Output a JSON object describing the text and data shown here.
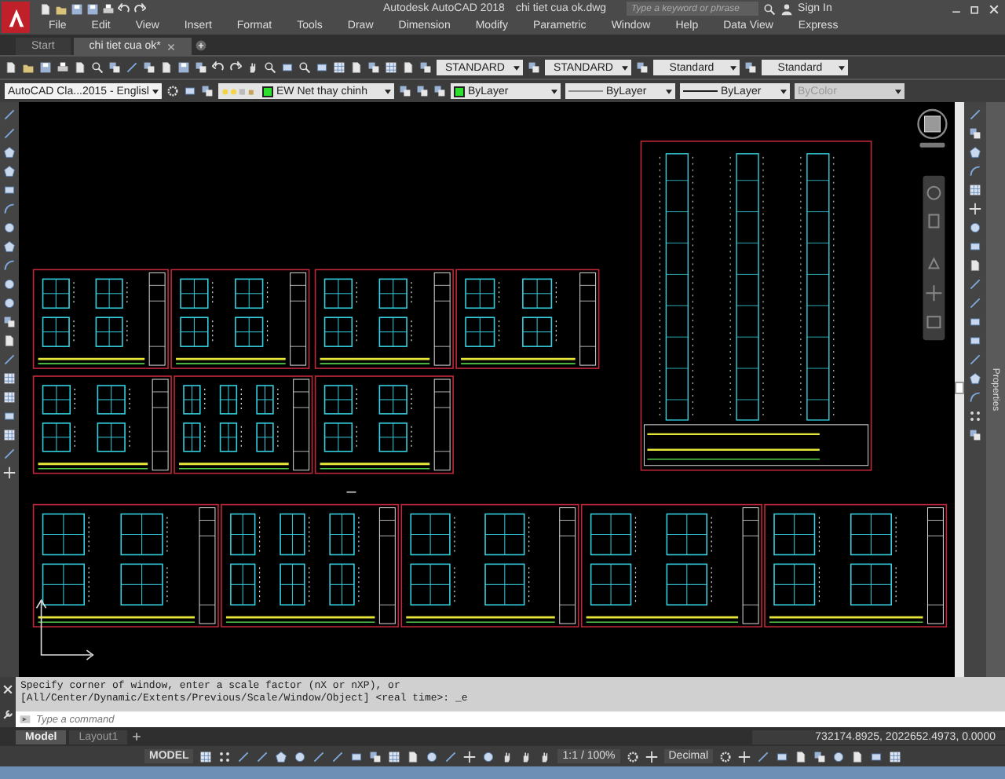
{
  "window": {
    "title": "Autodesk AutoCAD 2018",
    "file": "chi tiet cua ok.dwg"
  },
  "search": {
    "placeholder": "Type a keyword or phrase"
  },
  "account": {
    "label": "Sign In"
  },
  "menu": [
    "File",
    "Edit",
    "View",
    "Insert",
    "Format",
    "Tools",
    "Draw",
    "Dimension",
    "Modify",
    "Parametric",
    "Window",
    "Help",
    "Data View",
    "Express"
  ],
  "file_tabs": [
    {
      "label": "Start",
      "selected": false,
      "closable": false
    },
    {
      "label": "chi tiet cua ok*",
      "selected": true,
      "closable": true
    }
  ],
  "style_dropdowns": [
    "STANDARD",
    "STANDARD",
    "Standard",
    "Standard"
  ],
  "workspace": {
    "value": "AutoCAD Cla...2015 - Englisl"
  },
  "layer": {
    "name": "EW Net thay chinh"
  },
  "properties": [
    {
      "kind": "color",
      "value": "ByLayer",
      "disabled": false
    },
    {
      "kind": "linetype",
      "value": "ByLayer",
      "disabled": false
    },
    {
      "kind": "lineweight",
      "value": "ByLayer",
      "disabled": false
    },
    {
      "kind": "plotstyle",
      "value": "ByColor",
      "disabled": true
    }
  ],
  "command": {
    "history": [
      "Specify corner of window, enter a scale factor (nX or nXP), or",
      "[All/Center/Dynamic/Extents/Previous/Scale/Window/Object] <real time>: _e"
    ],
    "placeholder": "Type a command"
  },
  "layout_tabs": [
    {
      "label": "Model",
      "selected": true
    },
    {
      "label": "Layout1",
      "selected": false
    }
  ],
  "status_bar": {
    "space": "MODEL",
    "scale": "1:1 / 100%",
    "units": "Decimal",
    "coordinates": "732174.8925, 2022652.4973, 0.0000"
  },
  "side_panel": {
    "label": "Properties"
  }
}
